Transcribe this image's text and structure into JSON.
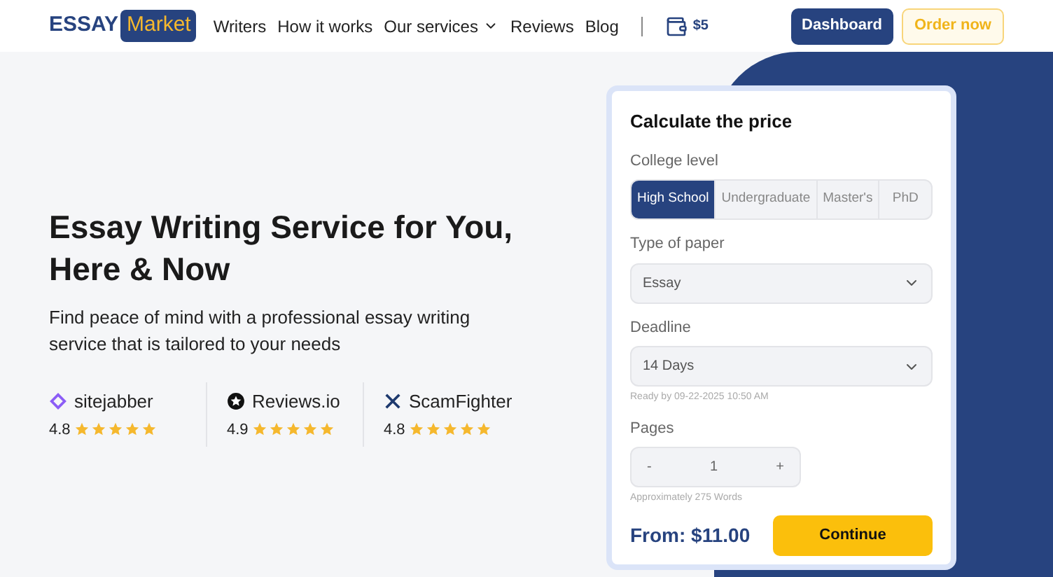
{
  "header": {
    "logo": {
      "left": "ESSAY",
      "right": "Market"
    },
    "nav": [
      {
        "label": "Writers",
        "kind": "link"
      },
      {
        "label": "How it works",
        "kind": "link"
      },
      {
        "label": "Our services",
        "kind": "dropdown"
      },
      {
        "label": "Reviews",
        "kind": "link"
      },
      {
        "label": "Blog",
        "kind": "link"
      }
    ],
    "balance": "$5",
    "buttons": [
      {
        "label": "Dashboard",
        "kind": "primary"
      },
      {
        "label": "Order now",
        "kind": "outline"
      }
    ]
  },
  "hero": {
    "title": "Essay Writing Service for You, Here & Now",
    "subtitle": "Find peace of mind with a professional essay writing service that is tailored to your needs",
    "ratings": [
      {
        "kind": "sitejabber",
        "name": "sitejabber",
        "score": "4.8",
        "stars": 5
      },
      {
        "kind": "reviewsio",
        "name": "Reviews.io",
        "score": "4.9",
        "stars": 5
      },
      {
        "kind": "scamfighter",
        "name": "ScamFighter",
        "score": "4.8",
        "stars": 5
      }
    ]
  },
  "calculator": {
    "title": "Calculate the price",
    "level_label": "College level",
    "levels": [
      {
        "label": "High School",
        "selected": true
      },
      {
        "label": "Undergraduate",
        "selected": false
      },
      {
        "label": "Master's",
        "selected": false
      },
      {
        "label": "PhD",
        "selected": false
      }
    ],
    "paper_label": "Type of paper",
    "paper": "Essay",
    "deadline_label": "Deadline",
    "deadline": "14 Days",
    "ready_by": "Ready by 09-22-2025 10:50 AM",
    "pages_label": "Pages",
    "minus": "-",
    "pages": "1",
    "plus": "+",
    "words": "Approximately 275 Words",
    "price": "From: $11.00",
    "continue": "Continue"
  }
}
